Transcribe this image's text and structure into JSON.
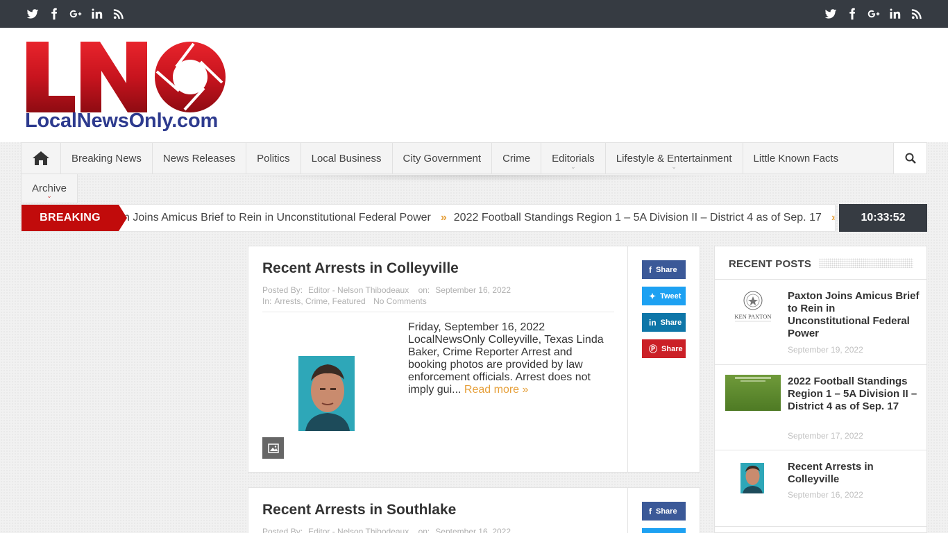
{
  "topbar": {
    "icons": [
      "twitter-icon",
      "facebook-icon",
      "google-plus-icon",
      "linkedin-icon",
      "rss-icon"
    ]
  },
  "logo": {
    "letters": "LNO",
    "url_text": "LocalNewsOnly.com",
    "colors": {
      "red": "#c8141e",
      "blue": "#2d3a8e"
    }
  },
  "nav": {
    "items": [
      {
        "label": "Breaking News",
        "has_dropdown": false
      },
      {
        "label": "News Releases",
        "has_dropdown": false
      },
      {
        "label": "Politics",
        "has_dropdown": false
      },
      {
        "label": "Local Business",
        "has_dropdown": false
      },
      {
        "label": "City Government",
        "has_dropdown": false
      },
      {
        "label": "Crime",
        "has_dropdown": false
      },
      {
        "label": "Editorials",
        "has_dropdown": true
      },
      {
        "label": "Lifestyle & Entertainment",
        "has_dropdown": true
      },
      {
        "label": "Little Known Facts",
        "has_dropdown": false
      }
    ],
    "second_row": {
      "label": "Archive",
      "has_dropdown": true
    }
  },
  "breaking": {
    "label": "BREAKING",
    "items": [
      "n Joins Amicus Brief to Rein in Unconstitutional Federal Power",
      "2022 Football Standings Region 1 – 5A Division II – District 4 as of Sep. 17"
    ],
    "clock": "10:33:52"
  },
  "articles": [
    {
      "title": "Recent Arrests in Colleyville",
      "posted_by_label": "Posted By:",
      "author": "Editor - Nelson Thibodeaux",
      "on_label": "on:",
      "date": "September 16, 2022",
      "in_label": "In:",
      "categories": "Arrests, Crime, Featured",
      "comments": "No Comments",
      "excerpt": "Friday, September 16, 2022 LocalNewsOnly Colleyville, Texas Linda Baker, Crime Reporter   Arrest and booking photos are provided by law enforcement officials.  Arrest does not imply gui...",
      "read_more": "Read more »",
      "share": [
        "Share",
        "Tweet",
        "Share",
        "Share"
      ]
    },
    {
      "title": "Recent Arrests in Southlake",
      "posted_by_label": "Posted By:",
      "author": "Editor - Nelson Thibodeaux",
      "on_label": "on:",
      "date": "September 16, 2022",
      "share": [
        "Share"
      ]
    }
  ],
  "sidebar": {
    "title": "RECENT POSTS",
    "posts": [
      {
        "title": "Paxton Joins Amicus Brief to Rein in Unconstitutional Federal Power",
        "date": "September 19, 2022",
        "thumb_caption": "KEN PAXTON"
      },
      {
        "title": "2022 Football Standings Region 1 – 5A Division II – District 4 as of Sep. 17",
        "date": "September 17, 2022"
      },
      {
        "title": "Recent Arrests in Colleyville",
        "date": "September 16, 2022"
      }
    ]
  },
  "colors": {
    "topbar": "#363b42",
    "breaking_red": "#c10b0b",
    "accent_orange": "#e6a03b",
    "facebook": "#3b5998",
    "twitter": "#1da1f2",
    "linkedin": "#0077b5",
    "pinterest": "#cb2027"
  }
}
